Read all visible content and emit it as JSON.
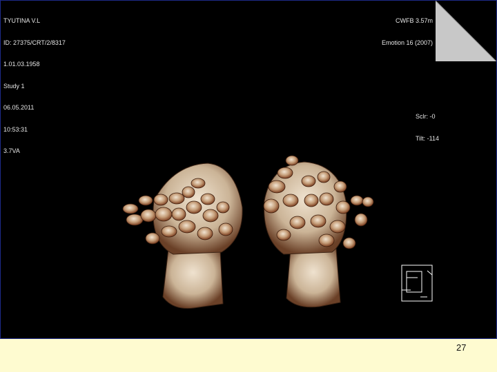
{
  "overlay_top_left": [
    "TYUTINA V.L",
    "ID: 27375/CRT/2/8317",
    "1.01.03.1958",
    "Study 1",
    "06.05.2011",
    "10:53:31",
    "3.7VA"
  ],
  "overlay_top_right": [
    "CWFB 3.57m",
    "Emotion 16 (2007)"
  ],
  "overlay_right": [
    "Sclr: -0",
    "Tilt: -114"
  ],
  "slide": {
    "number": "27"
  },
  "colors": {
    "viewer_background": "#000000",
    "slide_background": "#fefbd0",
    "viewer_border": "#1e2a8a",
    "corner_fold": "#c8c8c8",
    "bone": "#d9c6ad",
    "bone_shadow": "#7a4a2e"
  }
}
